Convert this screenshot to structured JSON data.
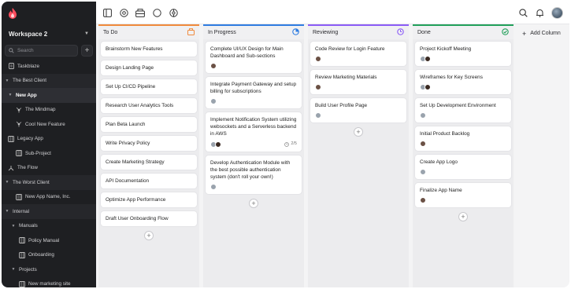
{
  "sidebar": {
    "workspace": "Workspace 2",
    "search_placeholder": "Search",
    "items": [
      {
        "label": "Taskblaze"
      },
      {
        "label": "The Best Client"
      },
      {
        "label": "New App"
      },
      {
        "label": "The Mindmap"
      },
      {
        "label": "Cool New Feature"
      },
      {
        "label": "Legacy App"
      },
      {
        "label": "Sub-Project"
      },
      {
        "label": "The Flow"
      },
      {
        "label": "The Worst Client"
      },
      {
        "label": "New App Name, Inc."
      },
      {
        "label": "Internal"
      },
      {
        "label": "Manuals"
      },
      {
        "label": "Policy Manual"
      },
      {
        "label": "Onboarding"
      },
      {
        "label": "Projects"
      },
      {
        "label": "New marketing site"
      }
    ]
  },
  "toolbar": {
    "icons": [
      "sidebar-toggle-icon",
      "eye-icon",
      "inbox-icon",
      "circle-icon",
      "settings-icon",
      "search-icon",
      "bell-icon",
      "avatar"
    ]
  },
  "colors": {
    "todo": "#f08a3c",
    "in_progress": "#2f7de1",
    "reviewing": "#8b5cf6",
    "done": "#22a05a"
  },
  "columns": [
    {
      "title": "To Do",
      "cards": [
        "Brainstorm New Features",
        "Design Landing Page",
        "Set Up CI/CD Pipeline",
        "Research User Analytics Tools",
        "Plan Beta Launch",
        "Write Privacy Policy",
        "Create Marketing Strategy",
        "API Documentation",
        "Optimize App Performance",
        "Draft User Onboarding Flow"
      ]
    },
    {
      "title": "In Progress",
      "cards": [
        {
          "title": "Complete UI/UX Design for Main Dashboard and Sub-sections"
        },
        {
          "title": "Integrate Payment Gateway and setup billing for subscriptions"
        },
        {
          "title": "Implement Notification System utilizing websockets and a Serverless backend in AWS",
          "subtasks": "2/5"
        },
        {
          "title": "Develop Authentication Module with the best possible authentication system (don't roll your own!)"
        }
      ]
    },
    {
      "title": "Reviewing",
      "cards": [
        {
          "title": "Code Review for Login Feature"
        },
        {
          "title": "Review Marketing Materials"
        },
        {
          "title": "Build User Profile Page"
        }
      ]
    },
    {
      "title": "Done",
      "cards": [
        {
          "title": "Project Kickoff Meeting"
        },
        {
          "title": "Wireframes for Key Screens"
        },
        {
          "title": "Set Up Development Environment"
        },
        {
          "title": "Initial Product Backlog"
        },
        {
          "title": "Create App Logo"
        },
        {
          "title": "Finalize App Name"
        }
      ]
    }
  ],
  "add_column_label": "Add Column"
}
